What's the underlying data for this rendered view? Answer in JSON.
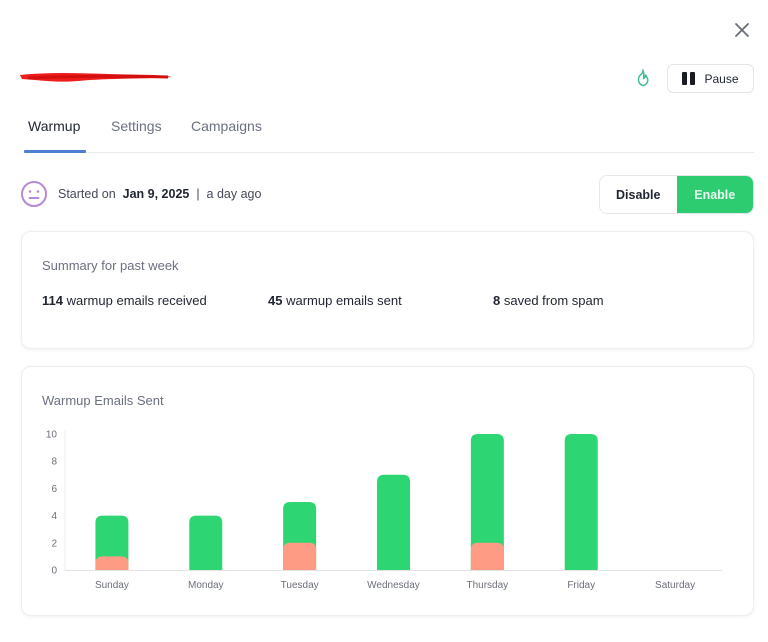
{
  "header": {
    "close_icon": "close-icon",
    "account_email_redacted": true,
    "fire_icon": "fire-icon",
    "pause_label": "Pause"
  },
  "tabs": [
    {
      "label": "Warmup",
      "active": true
    },
    {
      "label": "Settings",
      "active": false
    },
    {
      "label": "Campaigns",
      "active": false
    }
  ],
  "status": {
    "icon": "neutral-face-icon",
    "started_prefix": "Started on",
    "start_date": "Jan 9, 2025",
    "separator": "|",
    "relative": "a day ago"
  },
  "toggle": {
    "disable_label": "Disable",
    "enable_label": "Enable",
    "selected": "Enable"
  },
  "summary": {
    "title": "Summary for past week",
    "received_count": "114",
    "received_label": "warmup emails received",
    "sent_count": "45",
    "sent_label": "warmup emails sent",
    "spam_count": "8",
    "spam_label": "saved from spam"
  },
  "colors": {
    "accent_green": "#2ecc71",
    "bar_green": "#2ed573",
    "bar_salmon": "#fd9b85",
    "tab_underline": "#4f7fd1",
    "face_icon": "#b48ad6",
    "fire_icon": "#3cc08f"
  },
  "chart_data": {
    "type": "bar",
    "title": "Warmup Emails Sent",
    "xlabel": "",
    "ylabel": "",
    "categories": [
      "Sunday",
      "Monday",
      "Tuesday",
      "Wednesday",
      "Thursday",
      "Friday",
      "Saturday"
    ],
    "series": [
      {
        "name": "Sent",
        "color": "#2ed573",
        "values": [
          4,
          4,
          5,
          7,
          10,
          10,
          0
        ]
      },
      {
        "name": "Spam",
        "color": "#fd9b85",
        "values": [
          1,
          0,
          2,
          0,
          2,
          0,
          0
        ]
      }
    ],
    "overlap": true,
    "ylim": [
      0,
      10
    ],
    "yticks": [
      0,
      2,
      4,
      6,
      8,
      10
    ],
    "grid": false,
    "legend": "none"
  }
}
